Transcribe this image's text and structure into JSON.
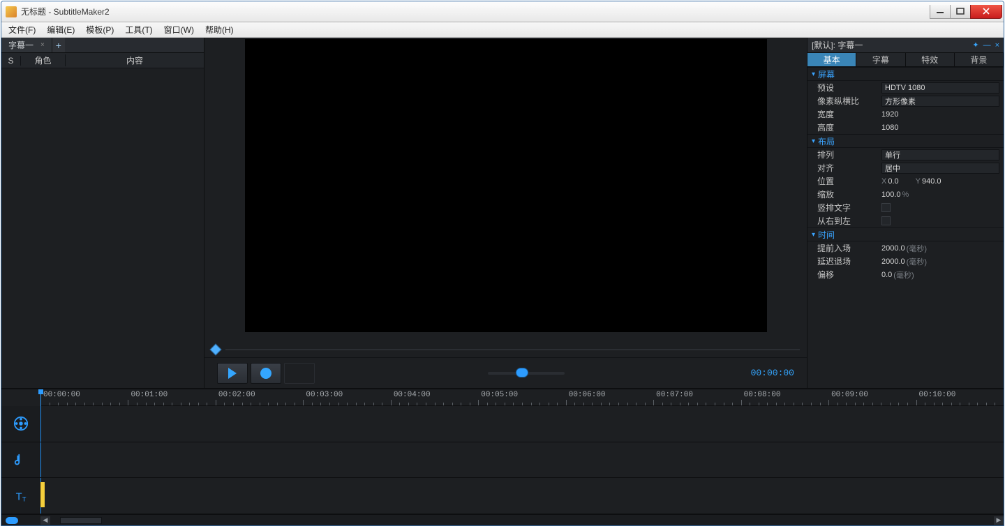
{
  "window": {
    "title": "无标题 - SubtitleMaker2"
  },
  "menu": {
    "file": "文件(F)",
    "edit": "编辑(E)",
    "template": "模板(P)",
    "tools": "工具(T)",
    "window": "窗口(W)",
    "help": "帮助(H)"
  },
  "left": {
    "tab": "字幕一",
    "add": "+",
    "hdr_s": "S",
    "hdr_role": "角色",
    "hdr_content": "内容"
  },
  "transport": {
    "timecode": "00:00:00"
  },
  "right": {
    "header": "[默认]: 字幕一",
    "tabs": {
      "basic": "基本",
      "subtitle": "字幕",
      "effect": "特效",
      "background": "背景"
    },
    "groups": {
      "screen": {
        "title": "屏幕",
        "preset_l": "预设",
        "preset_v": "HDTV 1080",
        "par_l": "像素纵横比",
        "par_v": "方形像素",
        "width_l": "宽度",
        "width_v": "1920",
        "height_l": "高度",
        "height_v": "1080"
      },
      "layout": {
        "title": "布局",
        "arrange_l": "排列",
        "arrange_v": "单行",
        "align_l": "对齐",
        "align_v": "居中",
        "pos_l": "位置",
        "pos_xl": "X",
        "pos_xv": "0.0",
        "pos_yl": "Y",
        "pos_yv": "940.0",
        "scale_l": "缩放",
        "scale_v": "100.0",
        "scale_unit": "%",
        "vertical_l": "竖排文字",
        "rtl_l": "从右到左"
      },
      "time": {
        "title": "时间",
        "prein_l": "提前入场",
        "prein_v": "2000.0",
        "prein_u": "(毫秒)",
        "postout_l": "延迟退场",
        "postout_v": "2000.0",
        "postout_u": "(毫秒)",
        "offset_l": "偏移",
        "offset_v": "0.0",
        "offset_u": "(毫秒)"
      }
    }
  },
  "timeline": {
    "labels": [
      "00:00:00",
      "00:01:00",
      "00:02:00",
      "00:03:00",
      "00:04:00",
      "00:05:00",
      "00:06:00",
      "00:07:00",
      "00:08:00",
      "00:09:00",
      "00:10:00"
    ]
  }
}
